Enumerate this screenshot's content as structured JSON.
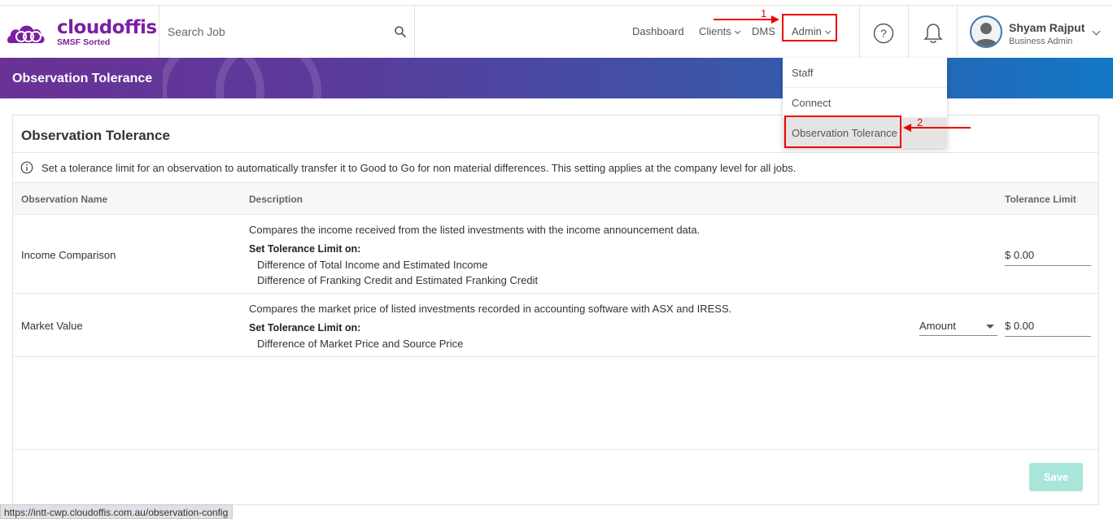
{
  "app": {
    "brand": "cloudoffis",
    "tagline": "SMSF Sorted"
  },
  "search": {
    "placeholder": "Search Job"
  },
  "nav": {
    "dashboard": "Dashboard",
    "clients": "Clients",
    "dms": "DMS",
    "admin": "Admin"
  },
  "user": {
    "name": "Shyam Rajput",
    "role": "Business Admin"
  },
  "banner": {
    "title": "Observation Tolerance"
  },
  "admin_menu": {
    "items": [
      {
        "label": "Staff"
      },
      {
        "label": "Connect"
      },
      {
        "label": "Observation Tolerance"
      }
    ]
  },
  "card": {
    "title": "Observation Tolerance",
    "info": "Set a tolerance limit for an observation to automatically transfer it to Good to Go for non material differences. This setting applies at the company level for all jobs.",
    "columns": {
      "name": "Observation Name",
      "description": "Description",
      "limit": "Tolerance Limit"
    },
    "rows": [
      {
        "name": "Income Comparison",
        "description": "Compares the income received from the listed investments with the income announcement data.",
        "set_label": "Set Tolerance Limit on:",
        "items": [
          "Difference of Total Income and Estimated Income",
          "Difference of Franking Credit and Estimated Franking Credit"
        ],
        "limit": "$ 0.00"
      },
      {
        "name": "Market Value",
        "description": "Compares the market price of listed investments recorded in accounting software with ASX and IRESS.",
        "set_label": "Set Tolerance Limit on:",
        "items": [
          "Difference of Market Price and Source Price"
        ],
        "type_select": "Amount",
        "limit": "$ 0.00"
      }
    ],
    "save_label": "Save"
  },
  "annotations": {
    "step1": "1",
    "step2": "2",
    "color": "#ee0000"
  },
  "status_url": "https://intt-cwp.cloudoffis.com.au/observation-config",
  "colors": {
    "brand": "#7b1fa2",
    "banner_start": "#6a3196",
    "banner_end": "#1278c6",
    "save_disabled": "#a8e6d9"
  }
}
